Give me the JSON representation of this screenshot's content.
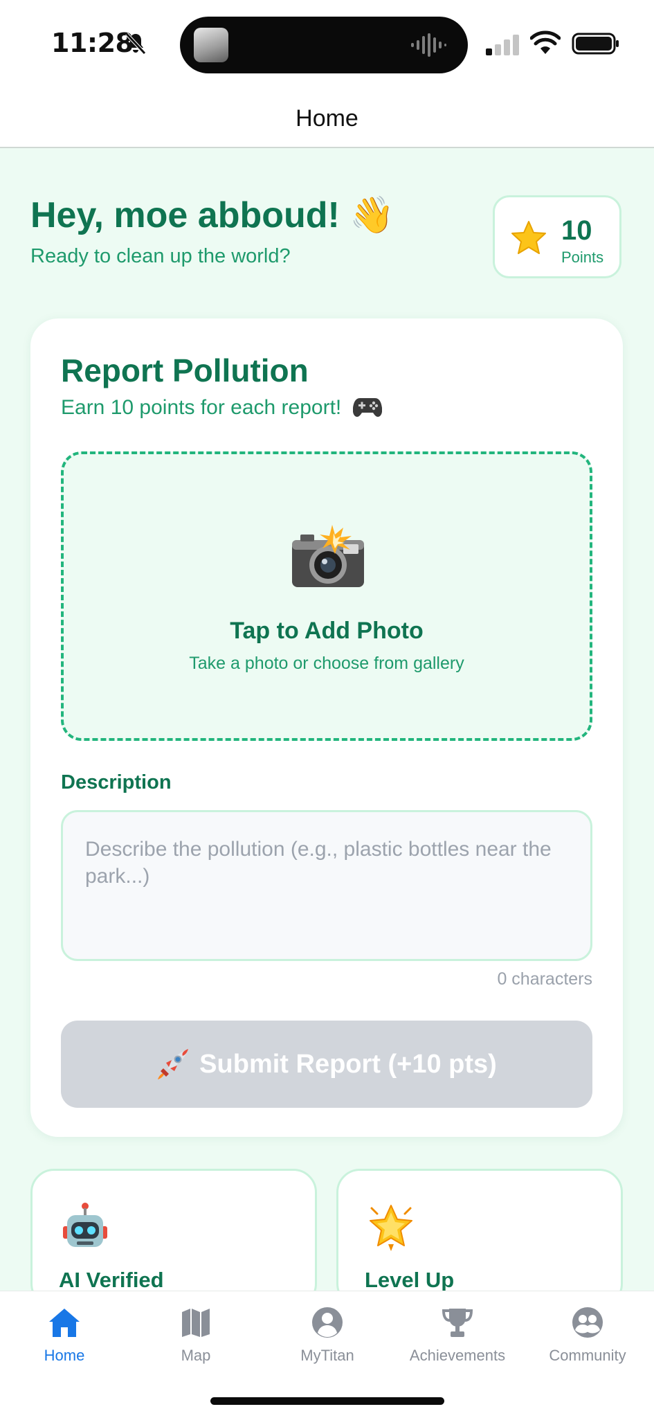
{
  "status_bar": {
    "time": "11:28"
  },
  "header": {
    "title": "Home"
  },
  "greeting": {
    "title": "Hey, moe abboud! 👋",
    "subtitle": "Ready to clean up the world?"
  },
  "points": {
    "value": "10",
    "label": "Points"
  },
  "report": {
    "title": "Report Pollution",
    "subtitle": "Earn 10 points for each report!",
    "photo_title": "Tap to Add Photo",
    "photo_subtitle": "Take a photo or choose from gallery",
    "description_label": "Description",
    "description_value": "",
    "description_placeholder": "Describe the pollution (e.g., plastic bottles near the park...)",
    "char_count": "0 characters",
    "submit_label": "Submit Report (+10 pts)"
  },
  "features": [
    {
      "title": "AI Verified",
      "icon": "robot-icon"
    },
    {
      "title": "Level Up",
      "icon": "glowing-star-icon"
    }
  ],
  "tabs": [
    {
      "label": "Home",
      "icon": "house-icon",
      "active": true
    },
    {
      "label": "Map",
      "icon": "map-icon",
      "active": false
    },
    {
      "label": "MyTitan",
      "icon": "person-icon",
      "active": false
    },
    {
      "label": "Achievements",
      "icon": "trophy-icon",
      "active": false
    },
    {
      "label": "Community",
      "icon": "community-icon",
      "active": false
    }
  ],
  "colors": {
    "primary_green": "#0f7451",
    "accent_green": "#22b57d",
    "background": "#edfbf3",
    "active_tab": "#1877e6",
    "disabled_button": "#d1d5db"
  }
}
